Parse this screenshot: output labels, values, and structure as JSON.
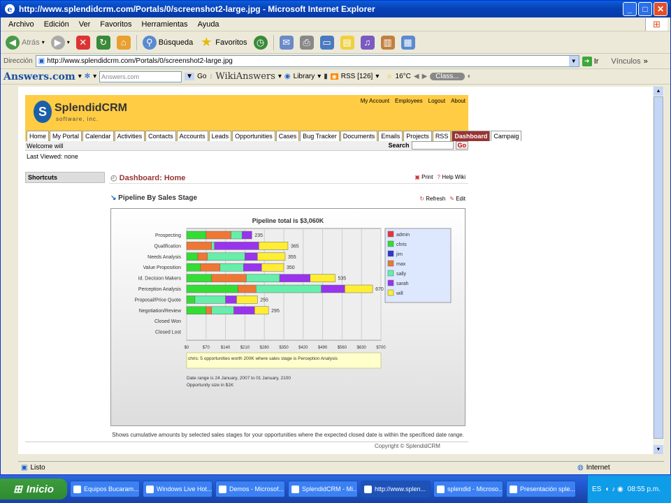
{
  "window": {
    "title": "http://www.splendidcrm.com/Portals/0/screenshot2-large.jpg - Microsoft Internet Explorer",
    "min": "_",
    "max": "□",
    "close": "✕"
  },
  "menu": [
    "Archivo",
    "Edición",
    "Ver",
    "Favoritos",
    "Herramientas",
    "Ayuda"
  ],
  "toolbar": {
    "back": "Atrás",
    "search": "Búsqueda",
    "favorites": "Favoritos"
  },
  "address": {
    "label": "Dirección",
    "url": "http://www.splendidcrm.com/Portals/0/screenshot2-large.jpg",
    "go": "Ir",
    "links": "Vínculos"
  },
  "answersbar": {
    "logo": "Answers.com",
    "input": "Answers.com",
    "go": "Go",
    "wiki": "WikiAnswers",
    "library": "Library",
    "rss": "RSS [126]",
    "temp": "16°C",
    "class": "Class..."
  },
  "crm": {
    "logo_text": "SplendidCRM",
    "logo_sub": "software, inc.",
    "toplinks": [
      "My Account",
      "Employees",
      "Logout",
      "About"
    ],
    "tabs": [
      "Home",
      "My Portal",
      "Calendar",
      "Activities",
      "Contacts",
      "Accounts",
      "Leads",
      "Opportunities",
      "Cases",
      "Bug Tracker",
      "Documents",
      "Emails",
      "Projects",
      "RSS",
      "Dashboard",
      "Campaig"
    ],
    "active_tab": "Dashboard",
    "welcome": "Welcome will",
    "search_label": "Search",
    "search_go": "Go",
    "last_viewed": "Last Viewed: none",
    "shortcuts": "Shortcuts",
    "dash_title": "Dashboard: Home",
    "print": "Print",
    "help": "Help Wiki",
    "pipe_title": "Pipeline By Sales Stage",
    "refresh": "Refresh",
    "edit": "Edit",
    "footnote": "Shows cumulative amounts by selected sales stages for your opportunities where the expected closed date is within the specificed date range.",
    "footline": "Copyright © SplendidCRM"
  },
  "chart_data": {
    "type": "bar",
    "orientation": "horizontal",
    "stacked": true,
    "title": "Pipeline total is $3,060K",
    "categories": [
      "Prospecting",
      "Qualification",
      "Needs Analysis",
      "Value Proposition",
      "Id. Decision Makers",
      "Perception Analysis",
      "Proposal/Price Quote",
      "Negotiation/Review",
      "Closed Won",
      "Closed Lost"
    ],
    "totals": [
      "235",
      "365",
      "355",
      "350",
      "535",
      "670",
      "255",
      "295",
      "",
      ""
    ],
    "xticks": [
      "$0",
      "$70",
      "$140",
      "$210",
      "$280",
      "$350",
      "$420",
      "$490",
      "$560",
      "$630",
      "$700"
    ],
    "xlim": [
      0,
      700
    ],
    "series": [
      {
        "name": "admin",
        "color": "#ee3333",
        "values": [
          0,
          0,
          0,
          0,
          0,
          0,
          0,
          0,
          0,
          0
        ]
      },
      {
        "name": "chris",
        "color": "#33dd33",
        "values": [
          70,
          0,
          40,
          50,
          90,
          185,
          30,
          70,
          0,
          0
        ]
      },
      {
        "name": "jim",
        "color": "#3333cc",
        "values": [
          0,
          0,
          0,
          0,
          0,
          0,
          0,
          0,
          0,
          0
        ]
      },
      {
        "name": "max",
        "color": "#ee7733",
        "values": [
          90,
          90,
          35,
          70,
          125,
          65,
          0,
          20,
          0,
          0
        ]
      },
      {
        "name": "sally",
        "color": "#66eeaa",
        "values": [
          40,
          10,
          135,
          85,
          120,
          235,
          110,
          80,
          0,
          0
        ]
      },
      {
        "name": "sarah",
        "color": "#9933ee",
        "values": [
          35,
          160,
          45,
          65,
          110,
          85,
          40,
          75,
          0,
          0
        ]
      },
      {
        "name": "will",
        "color": "#ffee33",
        "values": [
          0,
          105,
          100,
          80,
          90,
          100,
          75,
          50,
          0,
          0
        ]
      }
    ],
    "info": "chris: 5 opportunities worth 200K where sales stage is Perception Analysis",
    "date_range": "Date range is 24 January, 2007 to 01 January, 2100",
    "opp_size": "Opportunity size in $1K"
  },
  "status": {
    "left": "Listo",
    "zone": "Internet"
  },
  "taskbar": {
    "start": "Inicio",
    "tasks": [
      "Equipos Bucaram...",
      "Windows Live Hot...",
      "Demos - Microsof...",
      "SplendidCRM - Mi...",
      "http://www.splen...",
      "splendid - Microso...",
      "Presentación sple..."
    ],
    "active": 4,
    "lang": "ES",
    "clock": "08:55 p.m."
  }
}
